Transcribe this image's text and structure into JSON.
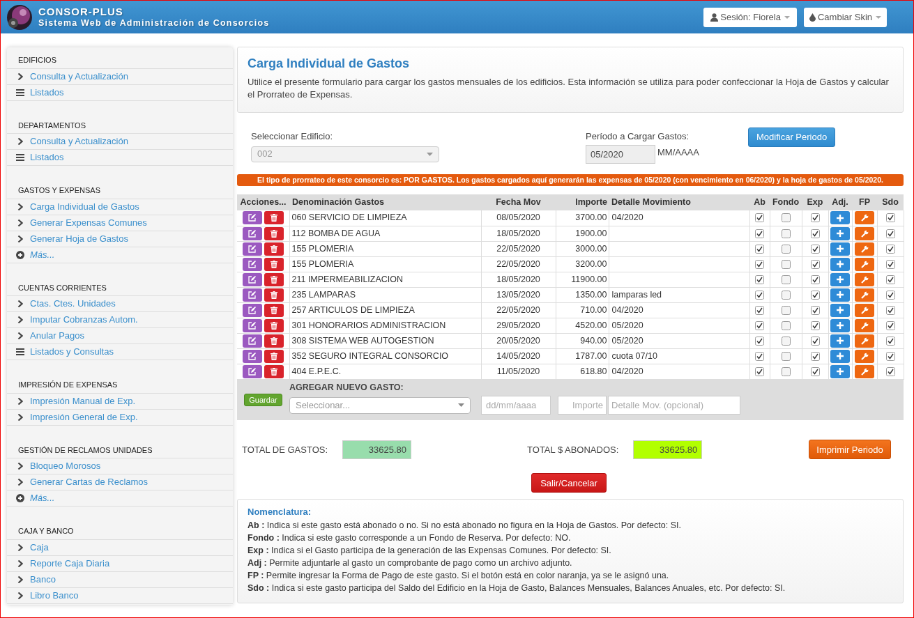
{
  "header": {
    "app_name": "CONSOR-PLUS",
    "subtitle": "Sistema Web de Administración de Consorcios",
    "session_button": "Sesión: Fiorela",
    "skin_button": "Cambiar Skin"
  },
  "sidebar": {
    "sections": [
      {
        "title": "EDIFICIOS",
        "items": [
          {
            "label": "Consulta y Actualización",
            "kind": "link"
          },
          {
            "label": "Listados",
            "kind": "list"
          }
        ]
      },
      {
        "title": "DEPARTAMENTOS",
        "items": [
          {
            "label": "Consulta y Actualización",
            "kind": "link"
          },
          {
            "label": "Listados",
            "kind": "list"
          }
        ]
      },
      {
        "title": "GASTOS Y EXPENSAS",
        "items": [
          {
            "label": "Carga Individual de Gastos",
            "kind": "link"
          },
          {
            "label": "Generar Expensas Comunes",
            "kind": "link"
          },
          {
            "label": "Generar Hoja de Gastos",
            "kind": "link"
          },
          {
            "label": "Más...",
            "kind": "more"
          }
        ]
      },
      {
        "title": "CUENTAS CORRIENTES",
        "items": [
          {
            "label": "Ctas. Ctes. Unidades",
            "kind": "link"
          },
          {
            "label": "Imputar Cobranzas Autom.",
            "kind": "link"
          },
          {
            "label": "Anular Pagos",
            "kind": "link"
          },
          {
            "label": "Listados y Consultas",
            "kind": "list"
          }
        ]
      },
      {
        "title": "IMPRESIÓN DE EXPENSAS",
        "items": [
          {
            "label": "Impresión Manual de Exp.",
            "kind": "link"
          },
          {
            "label": "Impresión General de Exp.",
            "kind": "link"
          }
        ]
      },
      {
        "title": "GESTIÓN DE RECLAMOS UNIDADES",
        "items": [
          {
            "label": "Bloqueo Morosos",
            "kind": "link"
          },
          {
            "label": "Generar Cartas de Reclamos",
            "kind": "link"
          },
          {
            "label": "Más...",
            "kind": "more"
          }
        ]
      },
      {
        "title": "CAJA Y BANCO",
        "items": [
          {
            "label": "Caja",
            "kind": "link"
          },
          {
            "label": "Reporte Caja Diaria",
            "kind": "link"
          },
          {
            "label": "Banco",
            "kind": "link"
          },
          {
            "label": "Libro Banco",
            "kind": "link"
          }
        ]
      }
    ]
  },
  "intro": {
    "title": "Carga Individual de Gastos",
    "text": "Utilice el presente formulario para cargar los gastos mensuales de los edificios. Esta información se utiliza para poder confeccionar la Hoja de Gastos y calcular el Prorrateo de Expensas."
  },
  "building": {
    "label": "Seleccionar Edificio:",
    "value": "002",
    "disabled": true
  },
  "period": {
    "label": "Período a Cargar Gastos:",
    "value": "05/2020",
    "format": "MM/AAAA",
    "button": "Modificar Periodo"
  },
  "notice": "El tipo de prorrateo de este consorcio es: POR GASTOS. Los gastos cargados aquí generarán las expensas de 05/2020 (con vencimiento en 06/2020) y la hoja de gastos de 05/2020.",
  "table": {
    "columns": [
      "Acciones...",
      "Denominación Gastos",
      "Fecha Mov",
      "Importe",
      "Detalle Movimiento",
      "Ab",
      "Fondo",
      "Exp",
      "Adj.",
      "FP",
      "Sdo"
    ],
    "rows": [
      {
        "name": "060 SERVICIO DE LIMPIEZA",
        "date": "08/05/2020",
        "amount": "3700.00",
        "detail": "04/2020",
        "ab": true,
        "fondo": false,
        "exp": true,
        "fp_assigned": true,
        "sdo": true
      },
      {
        "name": "112 BOMBA DE AGUA",
        "date": "18/05/2020",
        "amount": "1900.00",
        "ab": true,
        "fondo": false,
        "exp": true,
        "fp_assigned": true,
        "sdo": true
      },
      {
        "name": "155 PLOMERIA",
        "date": "22/05/2020",
        "amount": "3000.00",
        "ab": true,
        "fondo": false,
        "exp": true,
        "fp_assigned": true,
        "sdo": true
      },
      {
        "name": "155 PLOMERIA",
        "date": "22/05/2020",
        "amount": "3200.00",
        "ab": true,
        "fondo": false,
        "exp": true,
        "fp_assigned": true,
        "sdo": true
      },
      {
        "name": "211 IMPERMEABILIZACION",
        "date": "18/05/2020",
        "amount": "11900.00",
        "ab": true,
        "fondo": false,
        "exp": true,
        "fp_assigned": true,
        "sdo": true
      },
      {
        "name": "235 LAMPARAS",
        "date": "13/05/2020",
        "amount": "1350.00",
        "detail": "lamparas led",
        "ab": true,
        "fondo": false,
        "exp": true,
        "fp_assigned": true,
        "sdo": true
      },
      {
        "name": "257 ARTICULOS DE LIMPIEZA",
        "date": "22/05/2020",
        "amount": "710.00",
        "detail": "04/2020",
        "ab": true,
        "fondo": false,
        "exp": true,
        "fp_assigned": true,
        "sdo": true
      },
      {
        "name": "301 HONORARIOS ADMINISTRACION",
        "date": "29/05/2020",
        "amount": "4520.00",
        "detail": "05/2020",
        "ab": true,
        "fondo": false,
        "exp": true,
        "fp_assigned": true,
        "sdo": true
      },
      {
        "name": "308 SISTEMA WEB AUTOGESTION",
        "date": "20/05/2020",
        "amount": "940.00",
        "detail": "05/2020",
        "ab": true,
        "fondo": false,
        "exp": true,
        "fp_assigned": true,
        "sdo": true
      },
      {
        "name": "352 SEGURO INTEGRAL CONSORCIO",
        "date": "14/05/2020",
        "amount": "1787.00",
        "detail": "cuota 07/10",
        "ab": true,
        "fondo": false,
        "exp": true,
        "fp_assigned": true,
        "sdo": true
      },
      {
        "name": "404 E.P.E.C.",
        "date": "11/05/2020",
        "amount": "618.80",
        "detail": "04/2020",
        "ab": true,
        "fondo": false,
        "exp": true,
        "fp_assigned": true,
        "sdo": true
      }
    ]
  },
  "new_expense": {
    "title": "AGREGAR NUEVO GASTO:",
    "save_button": "Guardar",
    "select_placeholder": "Seleccionar...",
    "date_placeholder": "dd/mm/aaaa",
    "amount_placeholder": "Importe",
    "detail_placeholder": "Detalle Mov. (opcional)"
  },
  "totals": {
    "expenses_label": "TOTAL DE GASTOS:",
    "expenses_value": "33625.80",
    "paid_label": "TOTAL $ ABONADOS:",
    "paid_value": "33625.80",
    "print_button": "Imprimir Periodo"
  },
  "exit_button": "Salir/Cancelar",
  "legend": {
    "title": "Nomenclatura:",
    "entries": [
      "**Ab :** Indica si este gasto está abonado o no. Si no está abonado no figura en la Hoja de Gastos. Por defecto: SI.",
      "**Fondo :** Indica si este gasto corresponde a un Fondo de Reserva. Por defecto: NO.",
      "**Exp :** Indica si el Gasto participa de la generación de las Expensas Comunes. Por defecto: SI.",
      "**Adj :** Permite adjuntarle al gasto un comprobante de pago como un archivo adjunto.",
      "**FP :** Permite ingresar la Forma de Pago de este gasto. Si el botón está en color naranja, ya se le asignó una.",
      "**Sdo :** Indica si este gasto participa del Saldo del Edificio en la Hoja de Gasto, Balances Mensuales, Balances Anuales, etc. Por defecto: SI."
    ]
  }
}
